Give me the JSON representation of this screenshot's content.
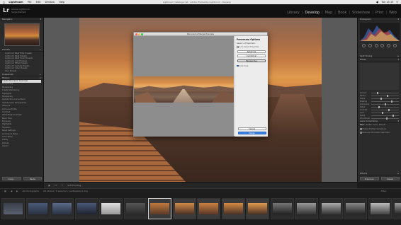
{
  "menubar": {
    "items": [
      "Lightroom",
      "File",
      "Edit",
      "Window",
      "Help"
    ],
    "doc_title": "Lightroom Catalog.lrcat - Adobe Photoshop Lightroom - Develop",
    "clock": "Tue 14:13"
  },
  "identity": {
    "logo": "Lr",
    "line1": "Adobe Lightroom",
    "line2": "Serge Ramelli"
  },
  "modules": [
    "Library",
    "Develop",
    "Map",
    "Book",
    "Slideshow",
    "Print",
    "Web"
  ],
  "active_module": "Develop",
  "left_panel": {
    "navigator_label": "Navigator",
    "presets_label": "Presets",
    "presets": [
      "Lightroom B&W Filter Presets",
      "Lightroom B&W Presets",
      "Lightroom B&W Toned Presets",
      "Lightroom Color Presets",
      "Lightroom Effect Presets",
      "Lightroom General Presets",
      "Lightroom Video Presets",
      "User Presets"
    ],
    "snapshots_label": "Snapshots",
    "history_label": "History",
    "history": [
      "Create Panoramic Overview",
      "Sharpening",
      "Sharpening",
      "Create Sharpening",
      "Highlights",
      "Sharpening",
      "Update Tone Curve Panel",
      "Update Color Temperature",
      "Vibrance",
      "Add Lens Profile",
      "Contrast",
      "White Balance Shade",
      "Basic Tone",
      "Exposure",
      "Highlights",
      "Shadows",
      "Reset Settings",
      "Luminance Noise",
      "Color Noise",
      "Clarity",
      "Dehaze",
      "Import"
    ],
    "copy_button": "Copy...",
    "paste_button": "Paste"
  },
  "dialog": {
    "title": "Panorama Merge Preview",
    "options_heading": "Panorama Options",
    "projection_label": "Select a Projection:",
    "auto_select_label": "Auto Select Projection",
    "projections": [
      "Spherical",
      "Cylindrical",
      "Perspective"
    ],
    "selected_projection": "Perspective",
    "auto_crop_label": "Auto Crop",
    "auto_crop_checked": true,
    "cancel_button": "Cancel",
    "merge_button": "Merge"
  },
  "right_panel": {
    "histogram_label": "Histogram",
    "section_labels": [
      "Split Toning",
      "Detail",
      "Lens Corrections",
      "Effects"
    ],
    "sliders": [
      "Amount",
      "Radius",
      "Detail",
      "Masking",
      "Luminance",
      "Detail",
      "Contrast",
      "Color",
      "Detail",
      "Smoothness"
    ],
    "lens_tabs": [
      "Basic",
      "Profile",
      "Color",
      "Manual"
    ],
    "lens_options": [
      "Enable Profile Corrections",
      "Remove Chromatic Aberration"
    ],
    "previous_button": "Previous",
    "reset_button": "Reset"
  },
  "toolbar": {
    "label": "Soft Proofing"
  },
  "filmstrip_header": {
    "source": "All Photographs",
    "count": "28 photos / 8 selected / JoelDesktop1.dng",
    "filter_label": "Filter:"
  },
  "colors": {
    "accent": "#3b82e6",
    "panel": "#2b2b2b",
    "workarea": "#5a5a5a"
  }
}
